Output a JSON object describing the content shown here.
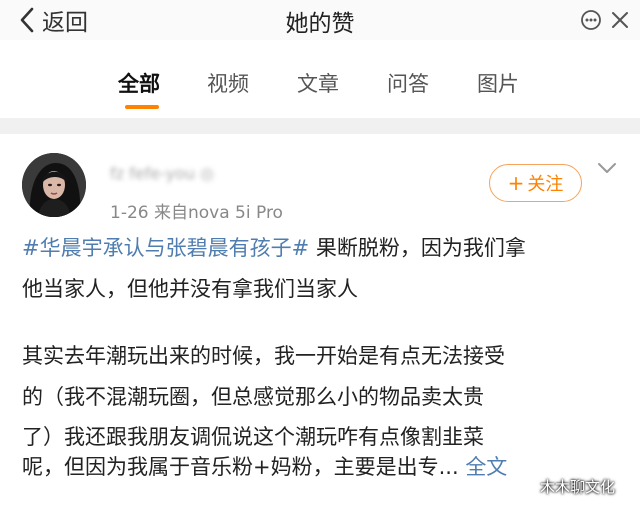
{
  "header": {
    "back_label": "返回",
    "title": "她的赞"
  },
  "tabs": [
    {
      "label": "全部",
      "active": true
    },
    {
      "label": "视频",
      "active": false
    },
    {
      "label": "文章",
      "active": false
    },
    {
      "label": "问答",
      "active": false
    },
    {
      "label": "图片",
      "active": false
    }
  ],
  "post": {
    "username": "fz fefe-you ◎",
    "meta": "1-26  来自nova 5i Pro",
    "follow_label": "关注",
    "topic": "#华晨宇承认与张碧晨有孩子#",
    "line1_rest": " 果断脱粉，因为我们拿",
    "line2": "他当家人，但他并没有拿我们当家人",
    "line3": "其实去年潮玩出来的时候，我一开始是有点无法接受",
    "line4": "的（我不混潮玩圈，但总感觉那么小的物品卖太贵",
    "line5": "了）我还跟我朋友调侃说这个潮玩咋有点像割韭菜",
    "line6": "呢，但因为我属于音乐粉+妈粉，主要是出专...",
    "full_text_link": "全文"
  },
  "watermark": "木木聊文化",
  "colors": {
    "accent": "#ff8200",
    "link": "#507daf",
    "separator": "#f0f0f0"
  }
}
